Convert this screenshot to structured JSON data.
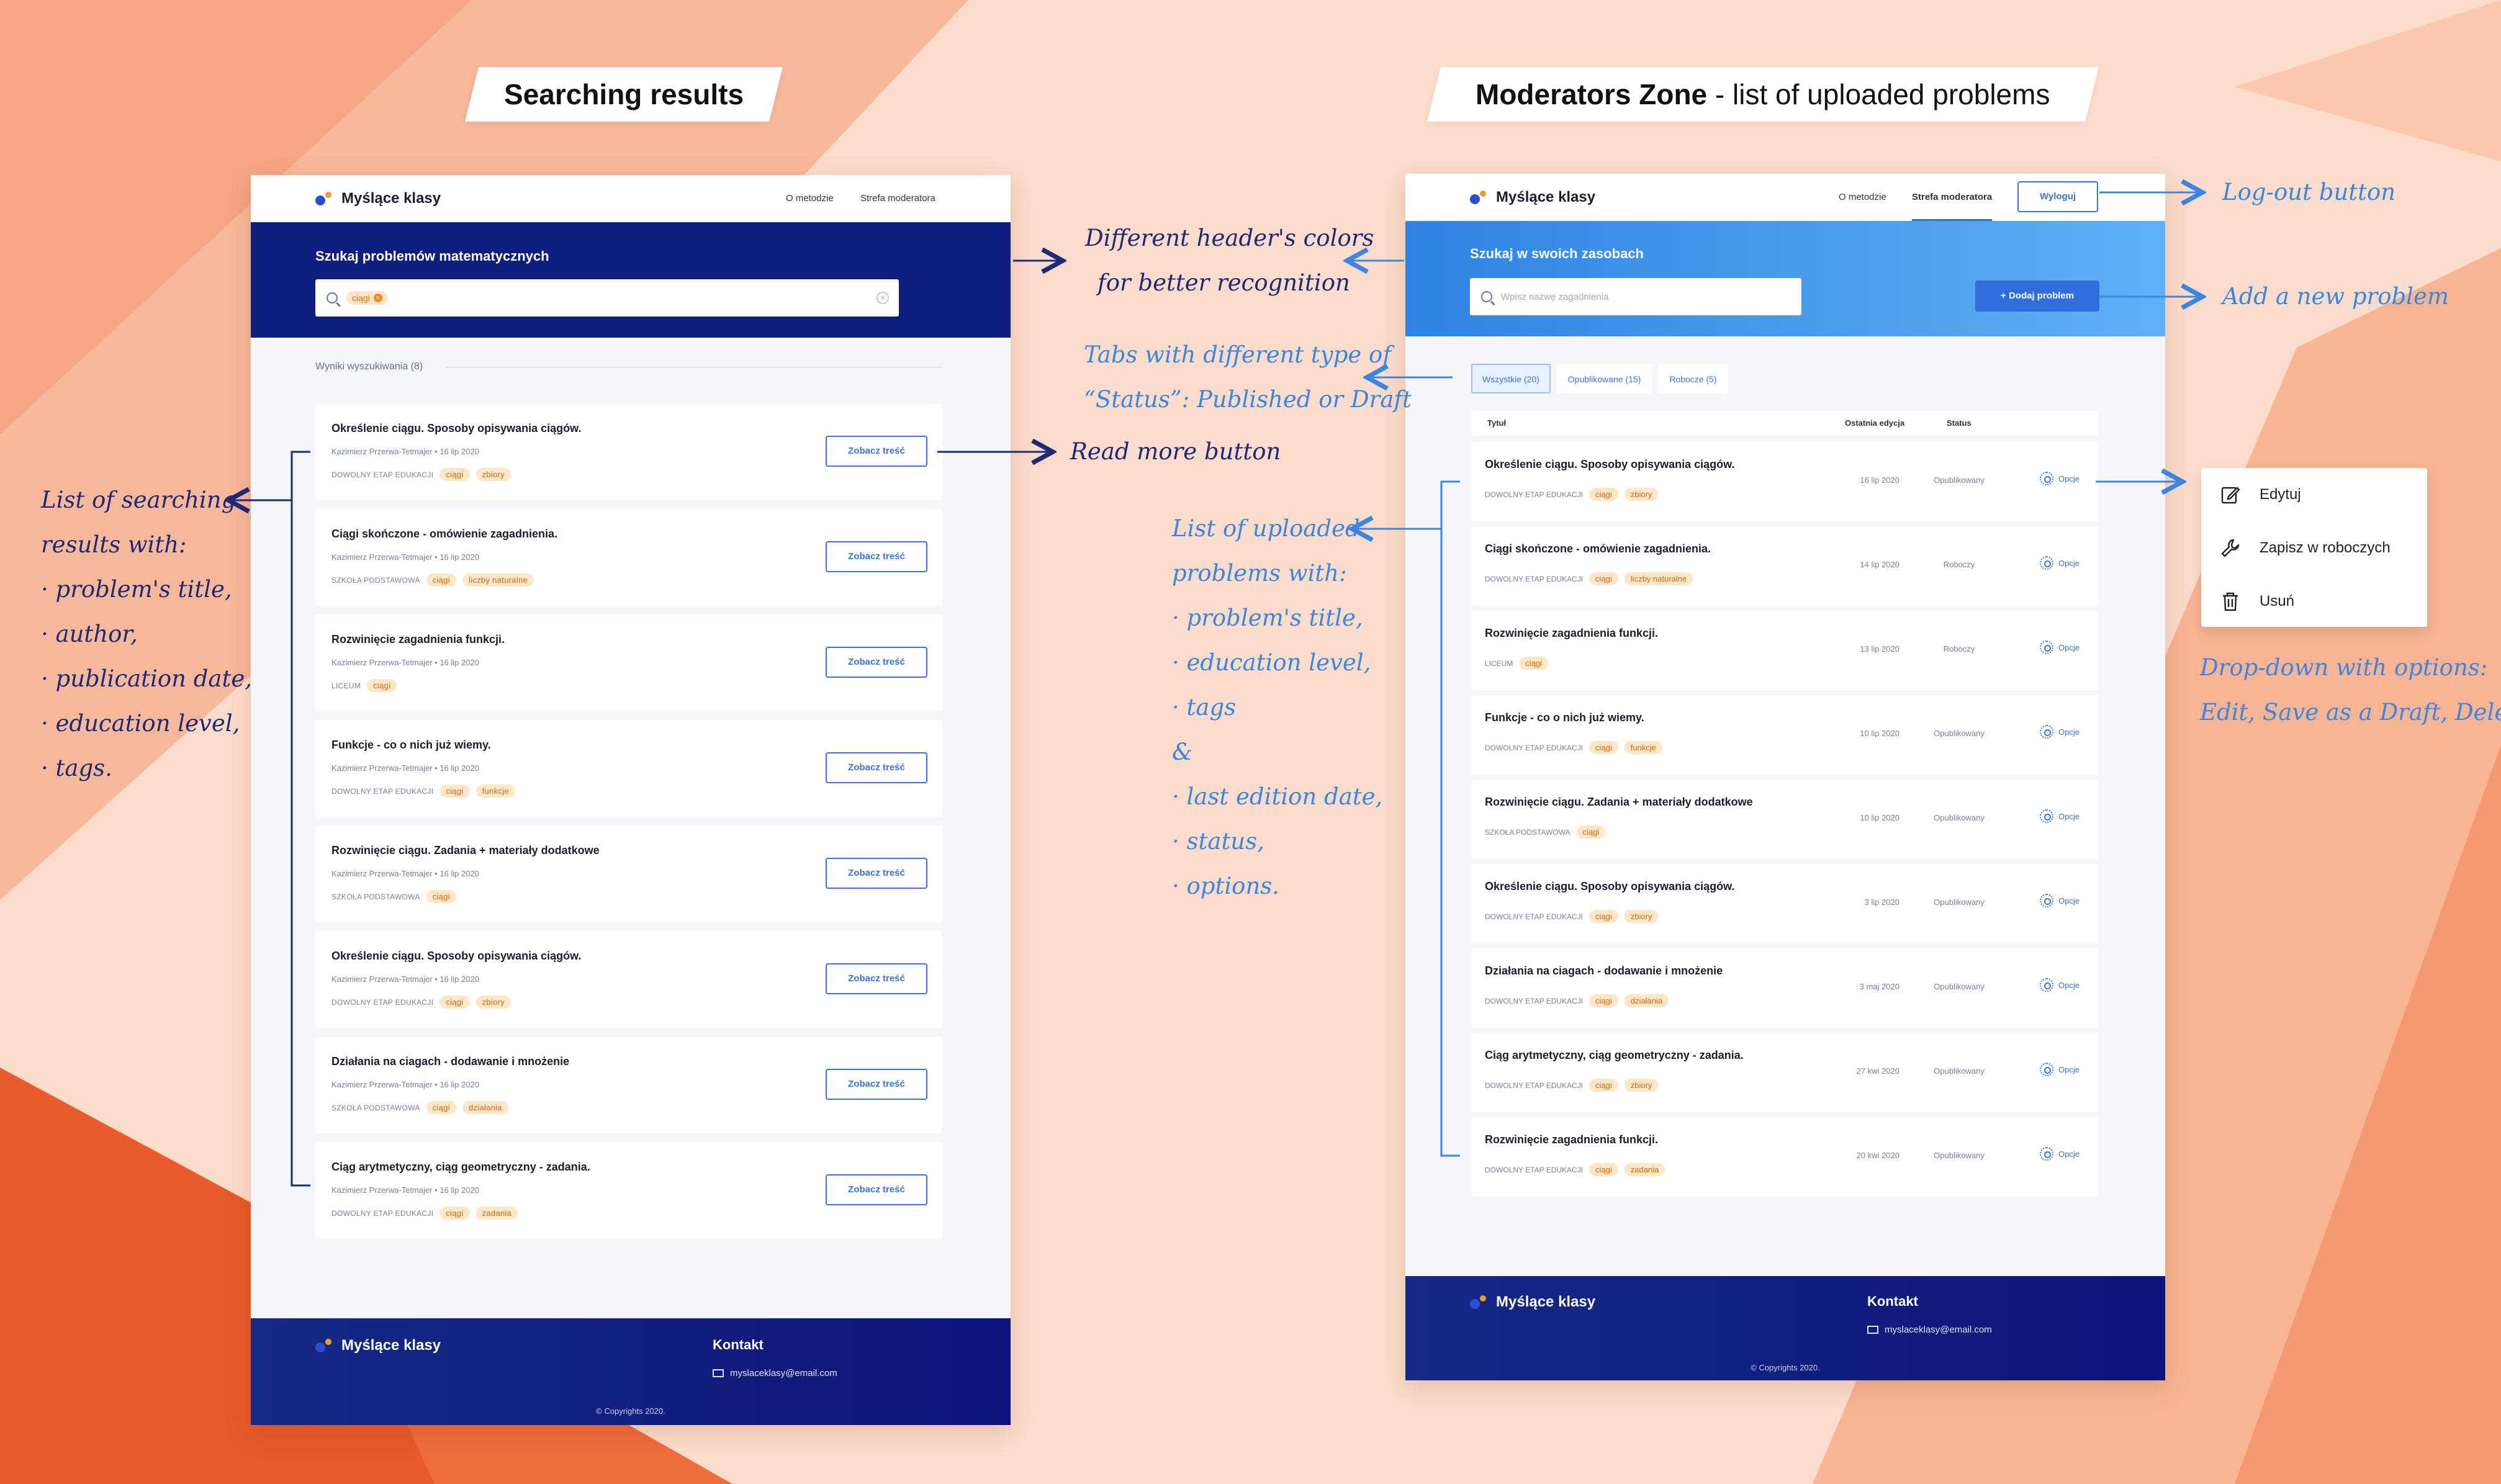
{
  "headings": {
    "search_bold": "Searching results",
    "moderator_bold": "Moderators Zone",
    "moderator_rest": " - list of uploaded problems"
  },
  "annotations": {
    "header_colors": [
      "Different header's colors",
      "for better recognition"
    ],
    "tabs": [
      "Tabs with different type of",
      "“Status”: Published or Draft"
    ],
    "read_more": "Read more button",
    "list_left": [
      "List of searching",
      "results with:",
      "· problem's title,",
      "· author,",
      "· publication date,",
      "· education level,",
      "· tags."
    ],
    "list_right": [
      "List of uploaded",
      "problems with:",
      "· problem's title,",
      "· education level,",
      "· tags",
      "&",
      "· last edition date,",
      "· status,",
      "· options."
    ],
    "logout": "Log-out button",
    "add_new": "Add a new problem",
    "dropdown": [
      "Drop-down with options:",
      "Edit, Save as a Draft, Delete"
    ]
  },
  "search_page": {
    "brand": "Myślące klasy",
    "nav": [
      "O metodzie",
      "Strefa moderatora"
    ],
    "hero_title": "Szukaj problemów matematycznych",
    "search_chip": "ciągi",
    "results_label": "Wyniki wyszukiwania (8)",
    "more_label": "Zobacz treść",
    "results": [
      {
        "title": "Określenie ciągu. Sposoby opisywania ciągów.",
        "author": "Kazimierz Przerwa-Tetmajer",
        "date": "16 lip 2020",
        "level": "DOWOLNY ETAP EDUKACJI",
        "tags": [
          "ciągi",
          "zbiory"
        ]
      },
      {
        "title": "Ciągi skończone - omówienie zagadnienia.",
        "author": "Kazimierz Przerwa-Tetmajer",
        "date": "16 lip 2020",
        "level": "SZKOŁA PODSTAWOWA",
        "tags": [
          "ciągi",
          "liczby naturalne"
        ]
      },
      {
        "title": "Rozwinięcie zagadnienia funkcji.",
        "author": "Kazimierz Przerwa-Tetmajer",
        "date": "16 lip 2020",
        "level": "LICEUM",
        "tags": [
          "ciągi"
        ]
      },
      {
        "title": "Funkcje - co o nich już wiemy.",
        "author": "Kazimierz Przerwa-Tetmajer",
        "date": "16 lip 2020",
        "level": "DOWOLNY ETAP EDUKACJI",
        "tags": [
          "ciągi",
          "funkcje"
        ]
      },
      {
        "title": "Rozwinięcie ciągu. Zadania + materiały dodatkowe",
        "author": "Kazimierz Przerwa-Tetmajer",
        "date": "16 lip 2020",
        "level": "SZKOŁA PODSTAWOWA",
        "tags": [
          "ciągi"
        ]
      },
      {
        "title": "Określenie ciągu. Sposoby opisywania ciągów.",
        "author": "Kazimierz Przerwa-Tetmajer",
        "date": "16 lip 2020",
        "level": "DOWOLNY ETAP EDUKACJI",
        "tags": [
          "ciągi",
          "zbiory"
        ]
      },
      {
        "title": "Działania na ciagach - dodawanie i mnożenie",
        "author": "Kazimierz Przerwa-Tetmajer",
        "date": "16 lip 2020",
        "level": "SZKOŁA PODSTAWOWA",
        "tags": [
          "ciągi",
          "działania"
        ]
      },
      {
        "title": "Ciąg arytmetyczny, ciąg geometryczny - zadania.",
        "author": "Kazimierz Przerwa-Tetmajer",
        "date": "16 lip 2020",
        "level": "DOWOLNY ETAP EDUKACJI",
        "tags": [
          "ciągi",
          "zadania"
        ]
      }
    ],
    "footer": {
      "brand": "Myślące klasy",
      "contact": "Kontakt",
      "email": "myslaceklasy@email.com",
      "copyright": "© Copyrights 2020."
    }
  },
  "mod_page": {
    "brand": "Myślące klasy",
    "nav": [
      "O metodzie",
      "Strefa moderatora"
    ],
    "logout": "Wyloguj",
    "hero_title": "Szukaj w swoich zasobach",
    "search_placeholder": "Wpisz nazwę zagadnienia",
    "add_button": "+ Dodaj problem",
    "tabs": [
      "Wszystkie (20)",
      "Opublikowane (15)",
      "Robocze (5)"
    ],
    "columns": [
      "Tytuł",
      "Ostatnia edycja",
      "Status"
    ],
    "options_label": "Opcje",
    "rows": [
      {
        "title": "Określenie ciągu. Sposoby opisywania ciągów.",
        "level": "DOWOLNY ETAP EDUKACJI",
        "tags": [
          "ciągi",
          "zbiory"
        ],
        "date": "16 lip 2020",
        "status": "Opublikowany"
      },
      {
        "title": "Ciągi skończone - omówienie zagadnienia.",
        "level": "DOWOLNY ETAP EDUKACJI",
        "tags": [
          "ciągi",
          "liczby naturalne"
        ],
        "date": "14 lip 2020",
        "status": "Roboczy"
      },
      {
        "title": "Rozwinięcie zagadnienia funkcji.",
        "level": "LICEUM",
        "tags": [
          "ciągi"
        ],
        "date": "13 lip 2020",
        "status": "Roboczy"
      },
      {
        "title": "Funkcje - co o nich już wiemy.",
        "level": "DOWOLNY ETAP EDUKACJI",
        "tags": [
          "ciągi",
          "funkcje"
        ],
        "date": "10 lip 2020",
        "status": "Opublikowany"
      },
      {
        "title": "Rozwinięcie ciągu. Zadania + materiały dodatkowe",
        "level": "SZKOŁA PODSTAWOWA",
        "tags": [
          "ciągi"
        ],
        "date": "10 lip 2020",
        "status": "Opublikowany"
      },
      {
        "title": "Określenie ciągu. Sposoby opisywania ciągów.",
        "level": "DOWOLNY ETAP EDUKACJI",
        "tags": [
          "ciągi",
          "zbiory"
        ],
        "date": "3 lip 2020",
        "status": "Opublikowany"
      },
      {
        "title": "Działania na ciagach - dodawanie i mnożenie",
        "level": "DOWOLNY ETAP EDUKACJI",
        "tags": [
          "ciągi",
          "działania"
        ],
        "date": "3 maj 2020",
        "status": "Opublikowany"
      },
      {
        "title": "Ciąg arytmetyczny, ciąg geometryczny - zadania.",
        "level": "DOWOLNY ETAP EDUKACJI",
        "tags": [
          "ciągi",
          "zbiory"
        ],
        "date": "27 kwi 2020",
        "status": "Opublikowany"
      },
      {
        "title": "Rozwinięcie zagadnienia funkcji.",
        "level": "DOWOLNY ETAP EDUKACJI",
        "tags": [
          "ciągi",
          "zadania"
        ],
        "date": "20 kwi 2020",
        "status": "Opublikowany"
      }
    ],
    "dropdown": [
      "Edytuj",
      "Zapisz w roboczych",
      "Usuń"
    ],
    "footer": {
      "brand": "Myślące klasy",
      "contact": "Kontakt",
      "email": "myslaceklasy@email.com",
      "copyright": "© Copyrights 2020."
    }
  },
  "colors": {
    "search_header": "#0f1f7f",
    "mod_header_from": "#2f84e3",
    "mod_header_to": "#5fb0f4",
    "accent": "#3d73d8",
    "tag_bg": "#fde7c8",
    "tag_text": "#c86a0c",
    "annotation_navy": "#1e2a78",
    "annotation_blue": "#3a86e0"
  }
}
